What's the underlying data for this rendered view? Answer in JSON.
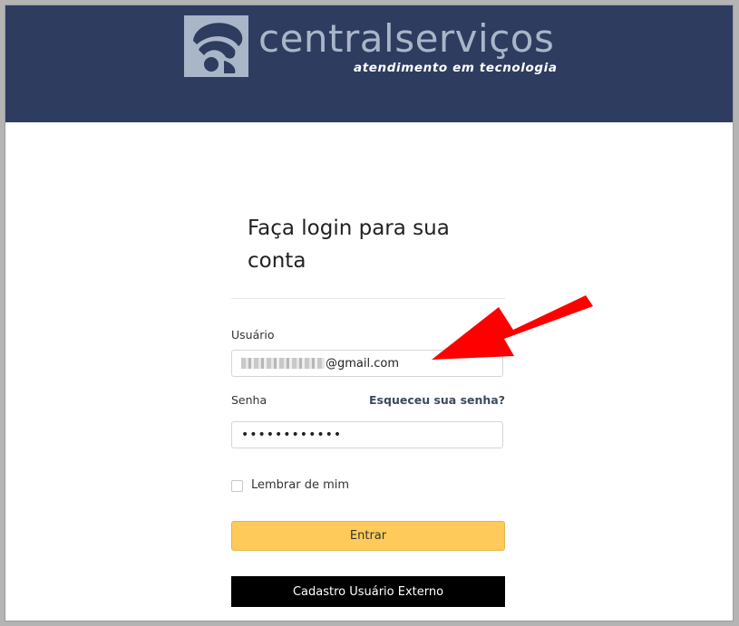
{
  "header": {
    "brand_name": "centralserviços",
    "tagline": "atendimento em tecnologia"
  },
  "login": {
    "title": "Faça login para sua conta",
    "username_label": "Usuário",
    "username_value": "@gmail.com",
    "password_label": "Senha",
    "forgot_password_link": "Esqueceu sua senha?",
    "password_value": "••••••••••••",
    "remember_me_label": "Lembrar de mim",
    "remember_me_checked": false,
    "submit_button_label": "Entrar",
    "register_button_label": "Cadastro Usuário Externo"
  },
  "annotation": {
    "icon": "arrow-pointer-icon",
    "color": "#ff0000"
  },
  "colors": {
    "header_bg": "#2e3c60",
    "logo_color": "#a9b6c8",
    "submit_bg": "#fecb5b",
    "register_bg": "#000000"
  }
}
